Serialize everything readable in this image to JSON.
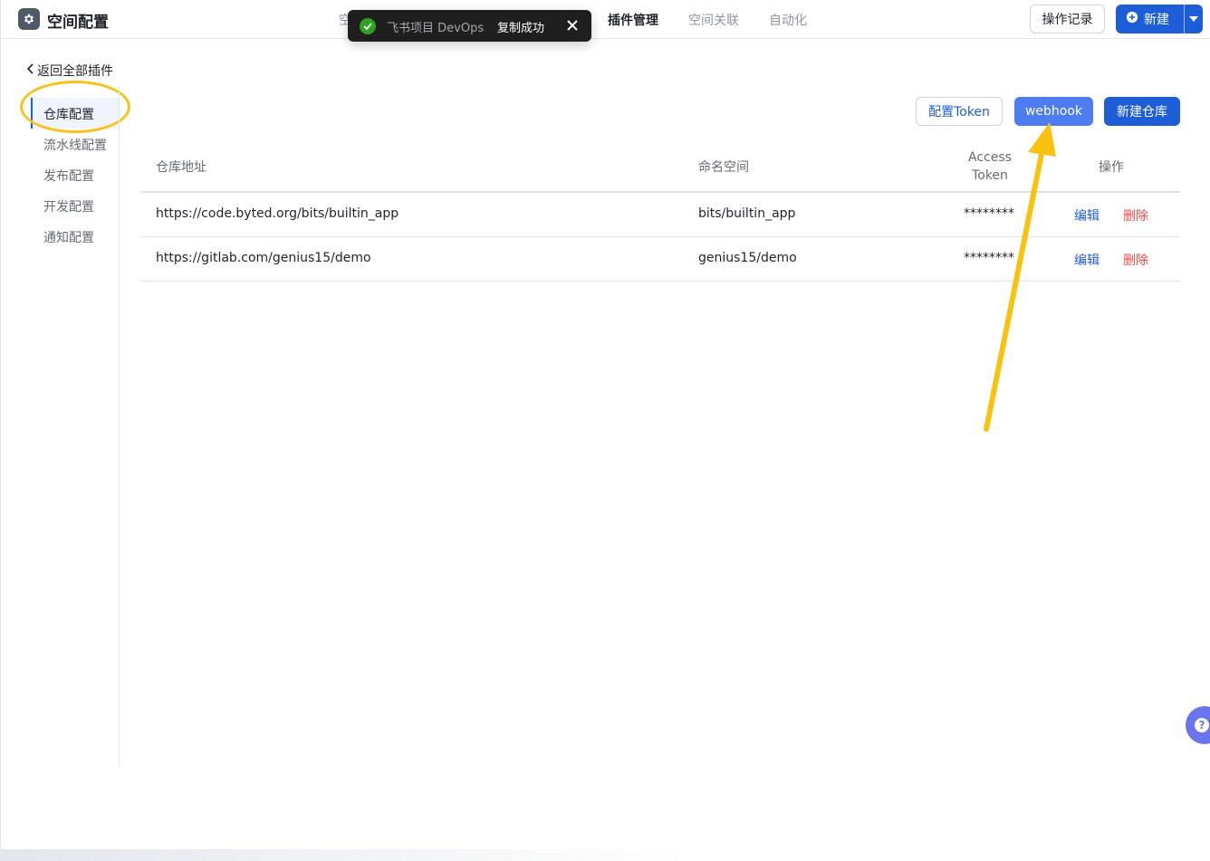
{
  "header": {
    "title": "空间配置",
    "nav_partial": "空",
    "nav": [
      {
        "label": "插件管理",
        "active": true
      },
      {
        "label": "空间关联",
        "active": false
      },
      {
        "label": "自动化",
        "active": false
      }
    ],
    "history_button": "操作记录",
    "new_button": "新建"
  },
  "toast": {
    "source": "飞书项目 DevOps",
    "message": "复制成功"
  },
  "sidebar": {
    "back_label": "返回全部插件",
    "items": [
      {
        "label": "仓库配置",
        "active": true
      },
      {
        "label": "流水线配置",
        "active": false
      },
      {
        "label": "发布配置",
        "active": false
      },
      {
        "label": "开发配置",
        "active": false
      },
      {
        "label": "通知配置",
        "active": false
      }
    ]
  },
  "toolbar": {
    "config_token": "配置Token",
    "webhook": "webhook",
    "create_repo": "新建仓库"
  },
  "table": {
    "columns": {
      "repo_url": "仓库地址",
      "namespace": "命名空间",
      "access_token_line1": "Access",
      "access_token_line2": "Token",
      "actions": "操作"
    },
    "rows": [
      {
        "url": "https://code.byted.org/bits/builtin_app",
        "namespace": "bits/builtin_app",
        "token": "********",
        "edit": "编辑",
        "delete": "删除"
      },
      {
        "url": "https://gitlab.com/genius15/demo",
        "namespace": "genius15/demo",
        "token": "********",
        "edit": "编辑",
        "delete": "删除"
      }
    ]
  },
  "help": {
    "label": "?"
  },
  "colors": {
    "primary": "#1d5ed8",
    "webhook": "#4c7cf0",
    "danger": "#f54a45",
    "success": "#2ea121",
    "highlight": "#f8c21b"
  },
  "icons": [
    "gear-icon",
    "plus-circle-icon",
    "caret-down-icon",
    "check-circle-icon",
    "close-icon",
    "chevron-left-icon",
    "help-icon",
    "arrow-annotation"
  ]
}
